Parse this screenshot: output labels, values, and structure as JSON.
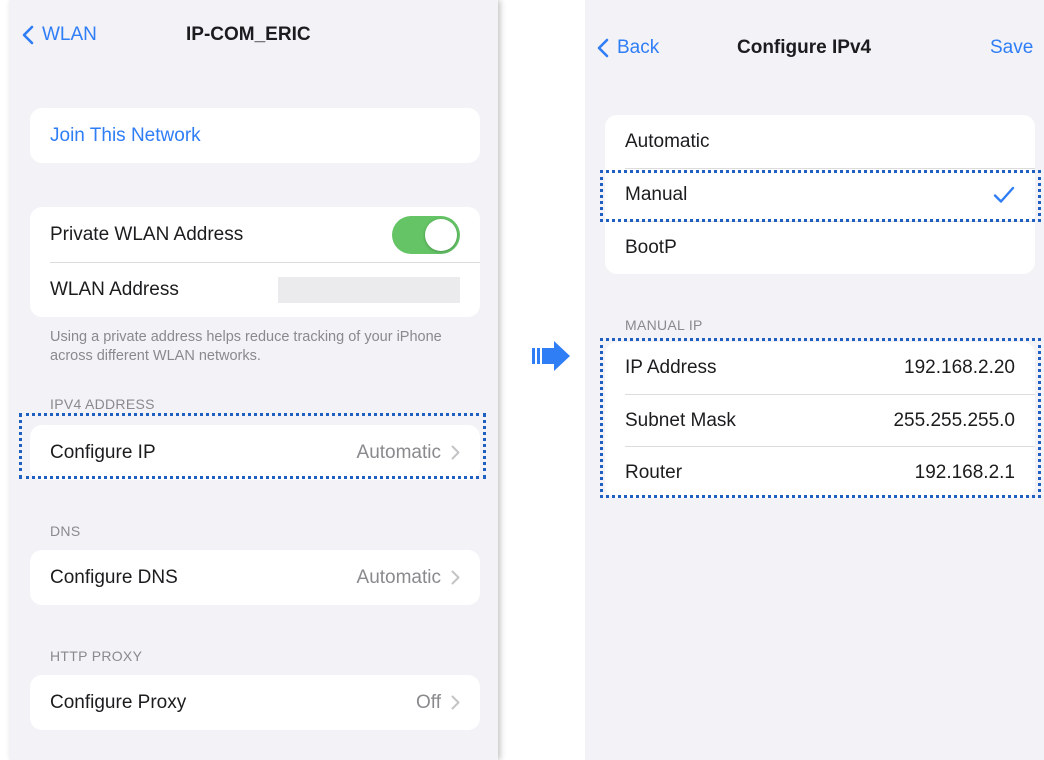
{
  "left_screen": {
    "nav": {
      "back_label": "WLAN",
      "title": "IP-COM_ERIC"
    },
    "join_network": {
      "label": "Join This Network"
    },
    "private_address": {
      "label": "Private WLAN Address",
      "enabled": true
    },
    "wlan_address": {
      "label": "WLAN Address",
      "value": ""
    },
    "footnote": "Using a private address helps reduce tracking of your iPhone across different WLAN networks.",
    "ipv4": {
      "section": "IPV4 ADDRESS",
      "label": "Configure IP",
      "value": "Automatic"
    },
    "dns": {
      "section": "DNS",
      "label": "Configure DNS",
      "value": "Automatic"
    },
    "proxy": {
      "section": "HTTP PROXY",
      "label": "Configure Proxy",
      "value": "Off"
    }
  },
  "right_screen": {
    "nav": {
      "back_label": "Back",
      "title": "Configure IPv4",
      "save_label": "Save"
    },
    "modes": [
      {
        "label": "Automatic",
        "selected": false
      },
      {
        "label": "Manual",
        "selected": true
      },
      {
        "label": "BootP",
        "selected": false
      }
    ],
    "manual_ip": {
      "section": "MANUAL IP",
      "fields": [
        {
          "label": "IP Address",
          "value": "192.168.2.20"
        },
        {
          "label": "Subnet Mask",
          "value": "255.255.255.0"
        },
        {
          "label": "Router",
          "value": "192.168.2.1"
        }
      ]
    }
  },
  "colors": {
    "accent": "#2f7ef6",
    "toggle_on": "#65c466",
    "highlight": "#1f5fc2",
    "background": "#f2f2f7"
  },
  "icons": [
    "chevron-left-icon",
    "chevron-right-icon",
    "checkmark-icon",
    "arrow-right-icon"
  ]
}
